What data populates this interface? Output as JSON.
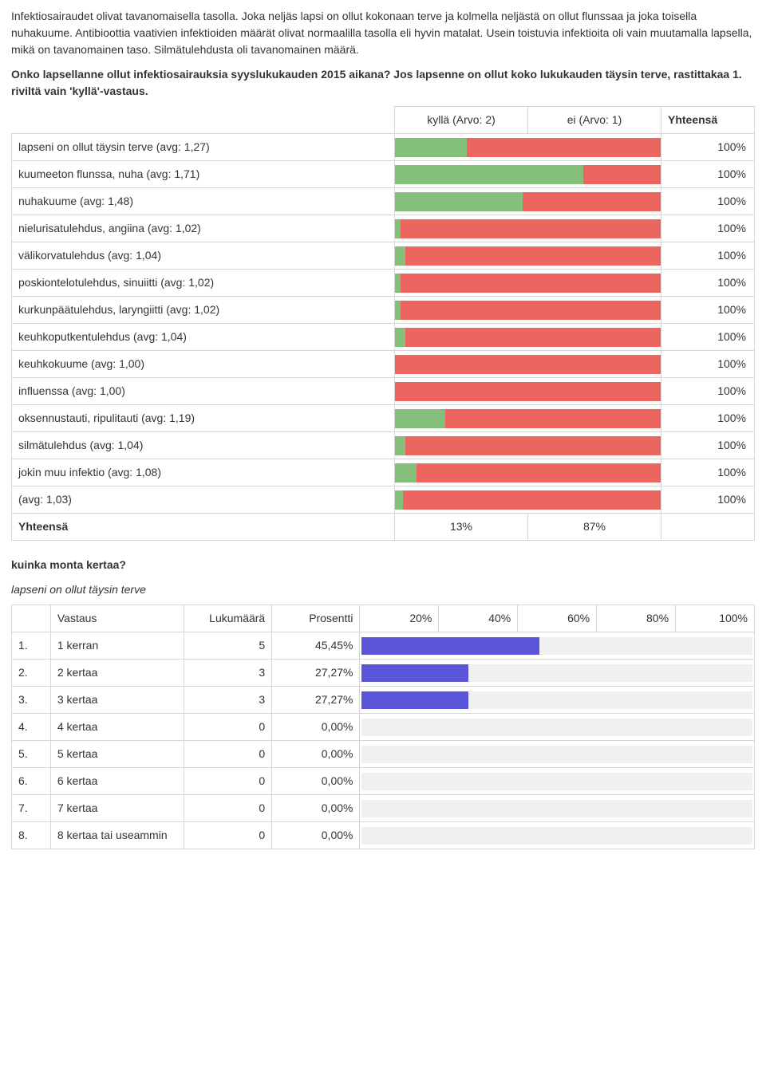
{
  "intro": "Infektiosairaudet olivat tavanomaisella tasolla. Joka neljäs lapsi on ollut kokonaan terve ja kolmella neljästä on ollut flunssaa ja joka toisella nuhakuume. Antibioottia vaativien infektioiden määrät olivat normaalilla tasolla eli hyvin matalat. Usein toistuvia infektioita oli vain muutamalla lapsella, mikä on tavanomainen taso. Silmätulehdusta oli tavanomainen määrä.",
  "question": "Onko lapsellanne ollut infektiosairauksia syyslukukauden 2015 aikana? Jos lapsenne on ollut koko lukukauden täysin terve, rastittakaa 1. riviltä vain 'kyllä'-vastaus.",
  "headers": {
    "col1": "kyllä (Arvo: 2)",
    "col2": "ei (Arvo: 1)",
    "total": "Yhteensä"
  },
  "chart_data": {
    "type": "bar",
    "legend": [
      "kyllä (Arvo: 2)",
      "ei (Arvo: 1)"
    ],
    "colors": [
      "#84bf7c",
      "#ec665f"
    ],
    "series": [
      {
        "label": "lapseni on ollut täysin terve (avg: 1,27)",
        "yes": 27,
        "no": 73,
        "total": "100%"
      },
      {
        "label": "kuumeeton flunssa, nuha (avg: 1,71)",
        "yes": 71,
        "no": 29,
        "total": "100%"
      },
      {
        "label": "nuhakuume (avg: 1,48)",
        "yes": 48,
        "no": 52,
        "total": "100%"
      },
      {
        "label": "nielurisatulehdus, angiina (avg: 1,02)",
        "yes": 2,
        "no": 98,
        "total": "100%"
      },
      {
        "label": "välikorvatulehdus (avg: 1,04)",
        "yes": 4,
        "no": 96,
        "total": "100%"
      },
      {
        "label": "poskiontelotulehdus, sinuiitti (avg: 1,02)",
        "yes": 2,
        "no": 98,
        "total": "100%"
      },
      {
        "label": "kurkunpäätulehdus, laryngiitti (avg: 1,02)",
        "yes": 2,
        "no": 98,
        "total": "100%"
      },
      {
        "label": "keuhkoputkentulehdus (avg: 1,04)",
        "yes": 4,
        "no": 96,
        "total": "100%"
      },
      {
        "label": "keuhkokuume (avg: 1,00)",
        "yes": 0,
        "no": 100,
        "total": "100%"
      },
      {
        "label": "influenssa (avg: 1,00)",
        "yes": 0,
        "no": 100,
        "total": "100%"
      },
      {
        "label": "oksennustauti, ripulitauti (avg: 1,19)",
        "yes": 19,
        "no": 81,
        "total": "100%"
      },
      {
        "label": "silmätulehdus (avg: 1,04)",
        "yes": 4,
        "no": 96,
        "total": "100%"
      },
      {
        "label": "jokin muu infektio (avg: 1,08)",
        "yes": 8,
        "no": 92,
        "total": "100%"
      },
      {
        "label": "(avg: 1,03)",
        "yes": 3,
        "no": 97,
        "total": "100%"
      }
    ],
    "totals": {
      "label": "Yhteensä",
      "yes": "13%",
      "no": "87%"
    }
  },
  "sub_question": "kuinka monta kertaa?",
  "sub_title_italic": "lapseni on ollut täysin terve",
  "freq": {
    "headers": {
      "answer": "Vastaus",
      "count": "Lukumäärä",
      "pct": "Prosentti"
    },
    "ticks": [
      "20%",
      "40%",
      "60%",
      "80%",
      "100%"
    ],
    "rows": [
      {
        "idx": "1.",
        "answer": "1 kerran",
        "count": "5",
        "pct": "45,45%",
        "bar": 45.45
      },
      {
        "idx": "2.",
        "answer": "2 kertaa",
        "count": "3",
        "pct": "27,27%",
        "bar": 27.27
      },
      {
        "idx": "3.",
        "answer": "3 kertaa",
        "count": "3",
        "pct": "27,27%",
        "bar": 27.27
      },
      {
        "idx": "4.",
        "answer": "4 kertaa",
        "count": "0",
        "pct": "0,00%",
        "bar": 0
      },
      {
        "idx": "5.",
        "answer": "5 kertaa",
        "count": "0",
        "pct": "0,00%",
        "bar": 0
      },
      {
        "idx": "6.",
        "answer": "6 kertaa",
        "count": "0",
        "pct": "0,00%",
        "bar": 0
      },
      {
        "idx": "7.",
        "answer": "7 kertaa",
        "count": "0",
        "pct": "0,00%",
        "bar": 0
      },
      {
        "idx": "8.",
        "answer": "8 kertaa tai useammin",
        "count": "0",
        "pct": "0,00%",
        "bar": 0
      }
    ]
  }
}
